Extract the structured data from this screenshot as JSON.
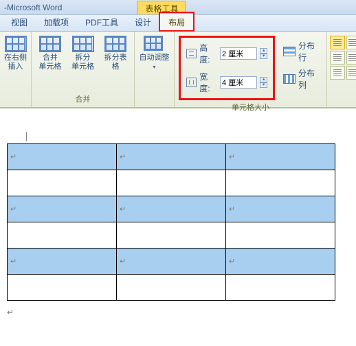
{
  "title": {
    "prefix": "- ",
    "app": "Microsoft Word"
  },
  "context_tab": "表格工具",
  "tabs": {
    "items": [
      {
        "label": "视图"
      },
      {
        "label": "加载项"
      },
      {
        "label": "PDF工具"
      },
      {
        "label": "设计"
      },
      {
        "label": "布局",
        "active": true
      }
    ]
  },
  "ribbon": {
    "insert": {
      "right_label": "在右侧插入"
    },
    "merge": {
      "merge_label": "合并\n单元格",
      "split_cell_label": "拆分\n单元格",
      "split_table_label": "拆分表格",
      "group_label": "合并"
    },
    "autofit": {
      "label": "自动调整"
    },
    "cellsize": {
      "height_label": "高度:",
      "height_value": "2 厘米",
      "width_label": "宽度:",
      "width_value": "4 厘米",
      "dist_rows": "分布行",
      "dist_cols": "分布列",
      "group_label": "单元格大小"
    }
  },
  "marks": {
    "para": "↵",
    "cell": "↵"
  }
}
